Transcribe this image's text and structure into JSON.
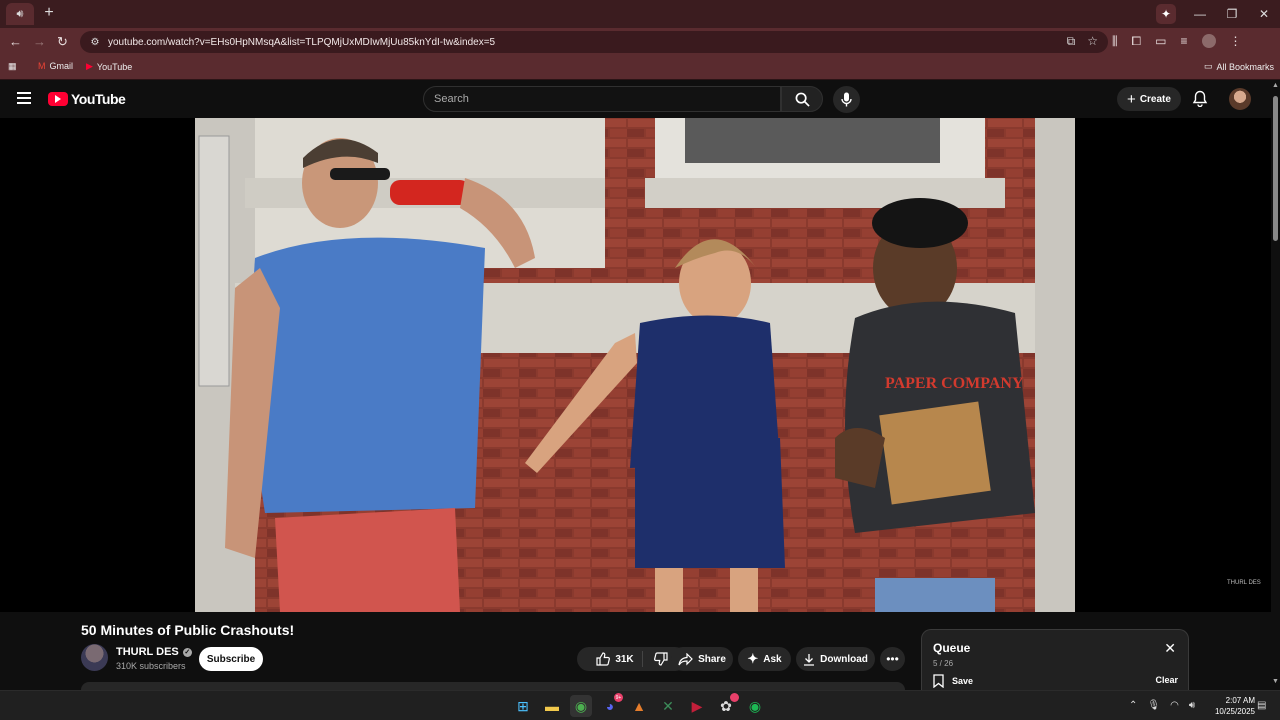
{
  "browser": {
    "tab_icon": "speaker-icon",
    "new_tab": "+",
    "window_controls": [
      "—",
      "❐",
      "✕"
    ],
    "url": "youtube.com/watch?v=EHs0HpNMsqA&list=TLPQMjUxMDIwMjUu85knYdI-tw&index=5",
    "bookmarks": [
      {
        "label": "Gmail",
        "icon": "gmail-icon",
        "color": "#ea4335"
      },
      {
        "label": "YouTube",
        "icon": "youtube-icon",
        "color": "#ff0033"
      }
    ],
    "all_bookmarks": "All Bookmarks",
    "theme_color": "#5a2b2f"
  },
  "youtube": {
    "logo_text": "YouTube",
    "search_placeholder": "Search",
    "create_label": "Create",
    "brand_color": "#ff0033"
  },
  "video": {
    "watermark": "THURL DES",
    "title": "50 Minutes of Public Crashouts!",
    "channel": {
      "name": "THURL DES",
      "subscribers": "310K subscribers",
      "subscribe_label": "Subscribe"
    },
    "actions": {
      "likes": "31K",
      "share": "Share",
      "ask": "Ask",
      "download": "Download"
    }
  },
  "queue": {
    "title": "Queue",
    "count": "5 / 26",
    "save": "Save",
    "clear": "Clear"
  },
  "taskbar": {
    "apps": [
      {
        "name": "windows-start-icon",
        "glyph": "⊞",
        "color": "#4cc2ff"
      },
      {
        "name": "file-explorer-icon",
        "glyph": "▬",
        "color": "#f2c94c"
      },
      {
        "name": "chrome-icon",
        "glyph": "◉",
        "color": "#4caf50"
      },
      {
        "name": "discord-icon",
        "glyph": "◕",
        "color": "#5865f2",
        "badge": "9+"
      },
      {
        "name": "app-a-icon",
        "glyph": "▲",
        "color": "#e57d2c"
      },
      {
        "name": "xbox-icon",
        "glyph": "✕",
        "color": "#3c8d5a"
      },
      {
        "name": "media-player-icon",
        "glyph": "▶",
        "color": "#c21f3a"
      },
      {
        "name": "chatgpt-icon",
        "glyph": "✿",
        "color": "#dddddd",
        "badge": " "
      },
      {
        "name": "spotify-icon",
        "glyph": "◉",
        "color": "#1db954"
      }
    ],
    "time": "2:07 AM",
    "date": "10/25/2025"
  }
}
